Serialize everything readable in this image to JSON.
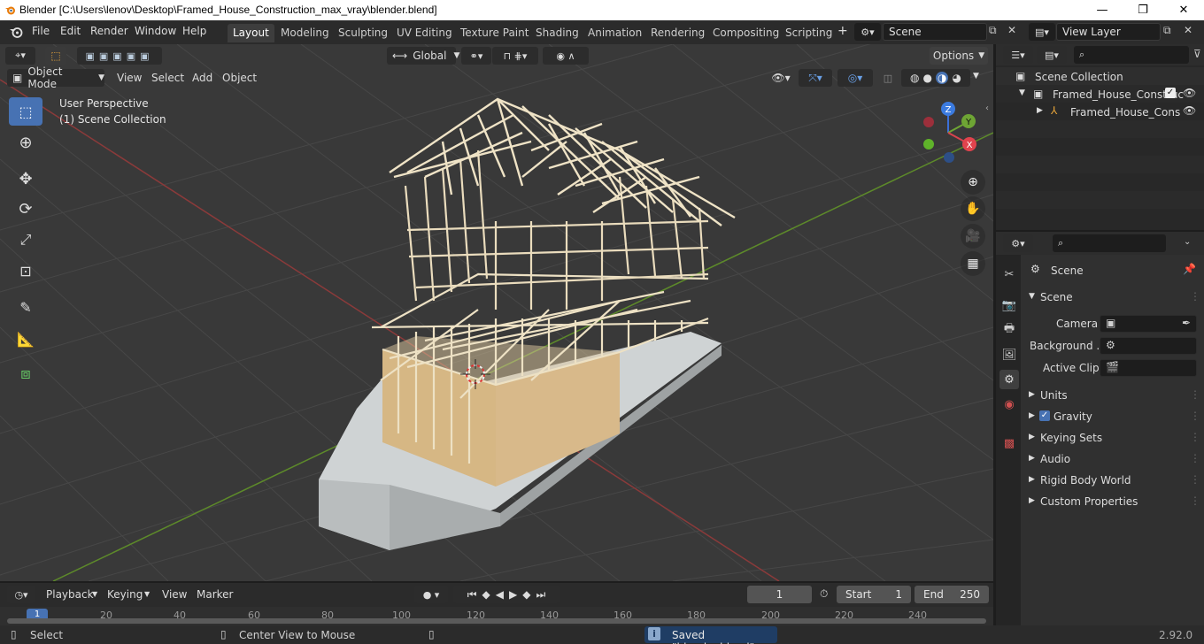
{
  "window": {
    "title": "Blender [C:\\Users\\lenov\\Desktop\\Framed_House_Construction_max_vray\\blender.blend]",
    "minimize": "—",
    "maximize": "❐",
    "close": "✕"
  },
  "menu": {
    "file": "File",
    "edit": "Edit",
    "render": "Render",
    "window": "Window",
    "help": "Help"
  },
  "workspaces": [
    "Layout",
    "Modeling",
    "Sculpting",
    "UV Editing",
    "Texture Paint",
    "Shading",
    "Animation",
    "Rendering",
    "Compositing",
    "Scripting"
  ],
  "workspace_add": "+",
  "scene_field": "Scene",
  "view_layer_field": "View Layer",
  "toolbar": {
    "orientation": "Global",
    "options": "Options"
  },
  "viewport_header": {
    "mode": "Object Mode",
    "view": "View",
    "select": "Select",
    "add": "Add",
    "object": "Object"
  },
  "viewport": {
    "perspective": "User Perspective",
    "collection": "(1) Scene Collection",
    "gizmo": {
      "z": "Z",
      "y": "Y",
      "x": "X"
    }
  },
  "outliner": {
    "root": "Scene Collection",
    "item1": "Framed_House_Construc",
    "item2": "Framed_House_Cons"
  },
  "properties": {
    "header": "Scene",
    "panel": "Scene",
    "camera_label": "Camera",
    "background_label": "Background ...",
    "active_clip_label": "Active Clip",
    "sections": [
      "Units",
      "Gravity",
      "Keying Sets",
      "Audio",
      "Rigid Body World",
      "Custom Properties"
    ]
  },
  "timeline": {
    "playback": "Playback",
    "keying": "Keying",
    "view": "View",
    "marker": "Marker",
    "current_frame": "1",
    "start_label": "Start",
    "start": "1",
    "end_label": "End",
    "end": "250",
    "ruler": [
      "1",
      "20",
      "40",
      "60",
      "80",
      "100",
      "120",
      "140",
      "160",
      "180",
      "200",
      "220",
      "240"
    ]
  },
  "status": {
    "select": "Select",
    "center_view": "Center View to Mouse",
    "saved": "Saved \"blender.blend\"",
    "version": "2.92.0"
  },
  "colors": {
    "accent": "#4772b3",
    "viewport_bg": "#393939",
    "axis_x": "#8b3a3a",
    "axis_y": "#5d8a2a",
    "wood": "#e8d9b6"
  }
}
